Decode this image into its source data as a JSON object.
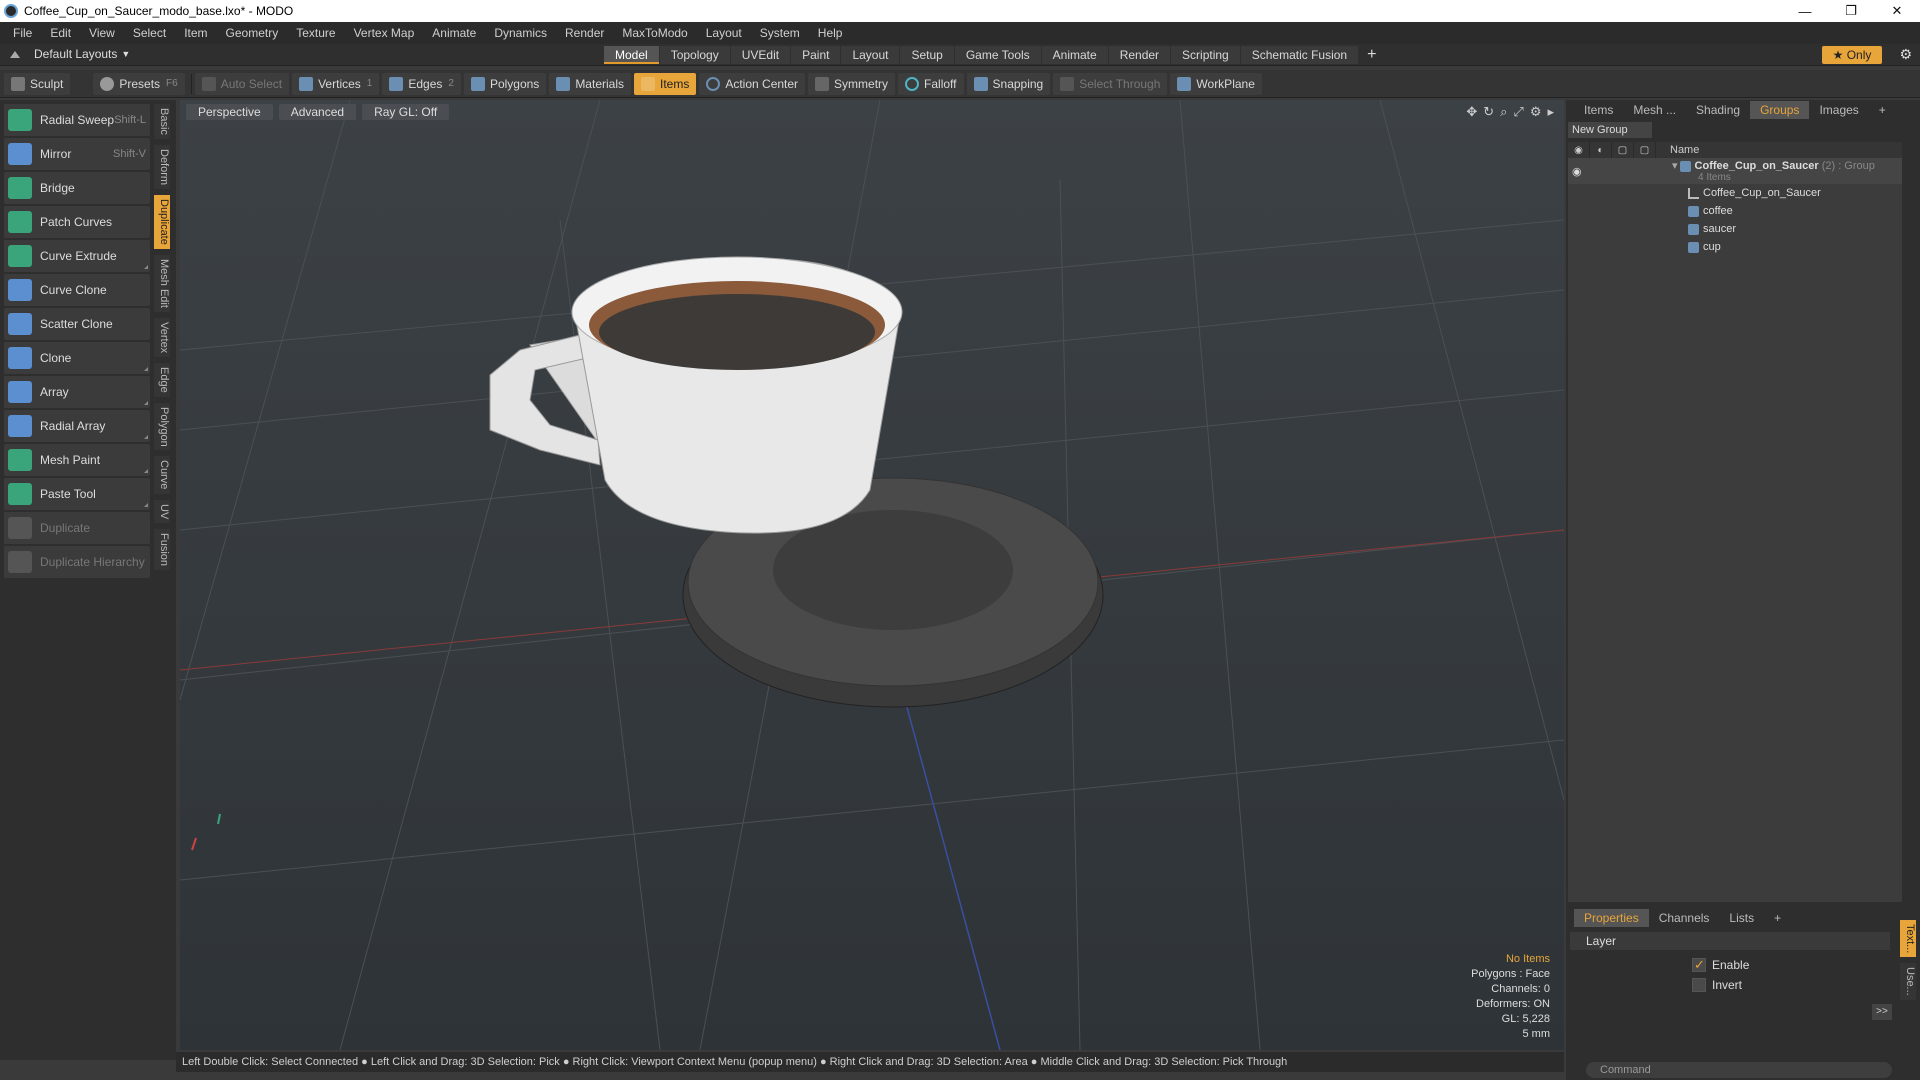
{
  "window": {
    "title": "Coffee_Cup_on_Saucer_modo_base.lxo* - MODO",
    "controls": [
      "—",
      "❐",
      "✕"
    ]
  },
  "menu": [
    "File",
    "Edit",
    "View",
    "Select",
    "Item",
    "Geometry",
    "Texture",
    "Vertex Map",
    "Animate",
    "Dynamics",
    "Render",
    "MaxToModo",
    "Layout",
    "System",
    "Help"
  ],
  "layout_bar": {
    "layout_name": "Default Layouts",
    "tabs": [
      "Model",
      "Topology",
      "UVEdit",
      "Paint",
      "Layout",
      "Setup",
      "Game Tools",
      "Animate",
      "Render",
      "Scripting",
      "Schematic Fusion"
    ],
    "active_tab": "Model",
    "plus": "+",
    "only_label": "★ Only"
  },
  "toolbar": {
    "sculpt": "Sculpt",
    "presets": "Presets",
    "presets_key": "F6",
    "auto_select": "Auto Select",
    "vertices": "Vertices",
    "vertices_key": "1",
    "edges": "Edges",
    "edges_key": "2",
    "polygons": "Polygons",
    "materials": "Materials",
    "items": "Items",
    "action_center": "Action Center",
    "symmetry": "Symmetry",
    "falloff": "Falloff",
    "snapping": "Snapping",
    "select_through": "Select Through",
    "workplane": "WorkPlane"
  },
  "tools": [
    {
      "label": "Radial Sweep",
      "key": "Shift-L",
      "color": "#3aa57a"
    },
    {
      "label": "Mirror",
      "key": "Shift-V",
      "color": "#5b8fd0"
    },
    {
      "label": "Bridge",
      "key": "",
      "color": "#3aa57a"
    },
    {
      "label": "Patch Curves",
      "key": "",
      "color": "#3aa57a"
    },
    {
      "label": "Curve Extrude",
      "key": "",
      "color": "#3aa57a"
    },
    {
      "label": "Curve Clone",
      "key": "",
      "color": "#5b8fd0"
    },
    {
      "label": "Scatter Clone",
      "key": "",
      "color": "#5b8fd0"
    },
    {
      "label": "Clone",
      "key": "",
      "color": "#5b8fd0"
    },
    {
      "label": "Array",
      "key": "",
      "color": "#5b8fd0"
    },
    {
      "label": "Radial Array",
      "key": "",
      "color": "#5b8fd0"
    },
    {
      "label": "Mesh Paint",
      "key": "",
      "color": "#3aa57a"
    },
    {
      "label": "Paste Tool",
      "key": "",
      "color": "#3aa57a"
    },
    {
      "label": "Duplicate",
      "key": "",
      "color": "#666"
    },
    {
      "label": "Duplicate Hierarchy",
      "key": "",
      "color": "#666"
    }
  ],
  "side_tabs": [
    "Basic",
    "Deform",
    "Duplicate",
    "Mesh Edit",
    "Vertex",
    "Edge",
    "Polygon",
    "Curve",
    "UV",
    "Fusion"
  ],
  "active_side_tab": "Duplicate",
  "viewport": {
    "buttons": [
      "Perspective",
      "Advanced",
      "Ray GL: Off"
    ],
    "info": {
      "no_items": "No Items",
      "polygons": "Polygons : Face",
      "channels": "Channels: 0",
      "deformers": "Deformers: ON",
      "gl": "GL: 5,228",
      "scale": "5 mm"
    }
  },
  "status": "Left Double Click: Select Connected ● Left Click and Drag: 3D Selection: Pick ● Right Click: Viewport Context Menu (popup menu) ● Right Click and Drag: 3D Selection: Area ● Middle Click and Drag: 3D Selection: Pick Through",
  "right_panel": {
    "tabs": [
      "Items",
      "Mesh ...",
      "Shading",
      "Groups",
      "Images",
      "+"
    ],
    "active_tab": "Groups",
    "new_group": "New Group",
    "name_col": "Name",
    "group": {
      "name": "Coffee_Cup_on_Saucer",
      "suffix": "(2) : Group",
      "count": "4 Items",
      "children": [
        "Coffee_Cup_on_Saucer",
        "coffee",
        "saucer",
        "cup"
      ]
    },
    "props_tabs": [
      "Properties",
      "Channels",
      "Lists",
      "+"
    ],
    "layer": "Layer",
    "enable": "Enable",
    "invert": "Invert",
    "more": ">>",
    "command_placeholder": "Command",
    "side_tabs": [
      "Text...",
      "Use..."
    ]
  },
  "colors": {
    "accent": "#e8a53a",
    "viewport_bg": "#353a3e"
  }
}
